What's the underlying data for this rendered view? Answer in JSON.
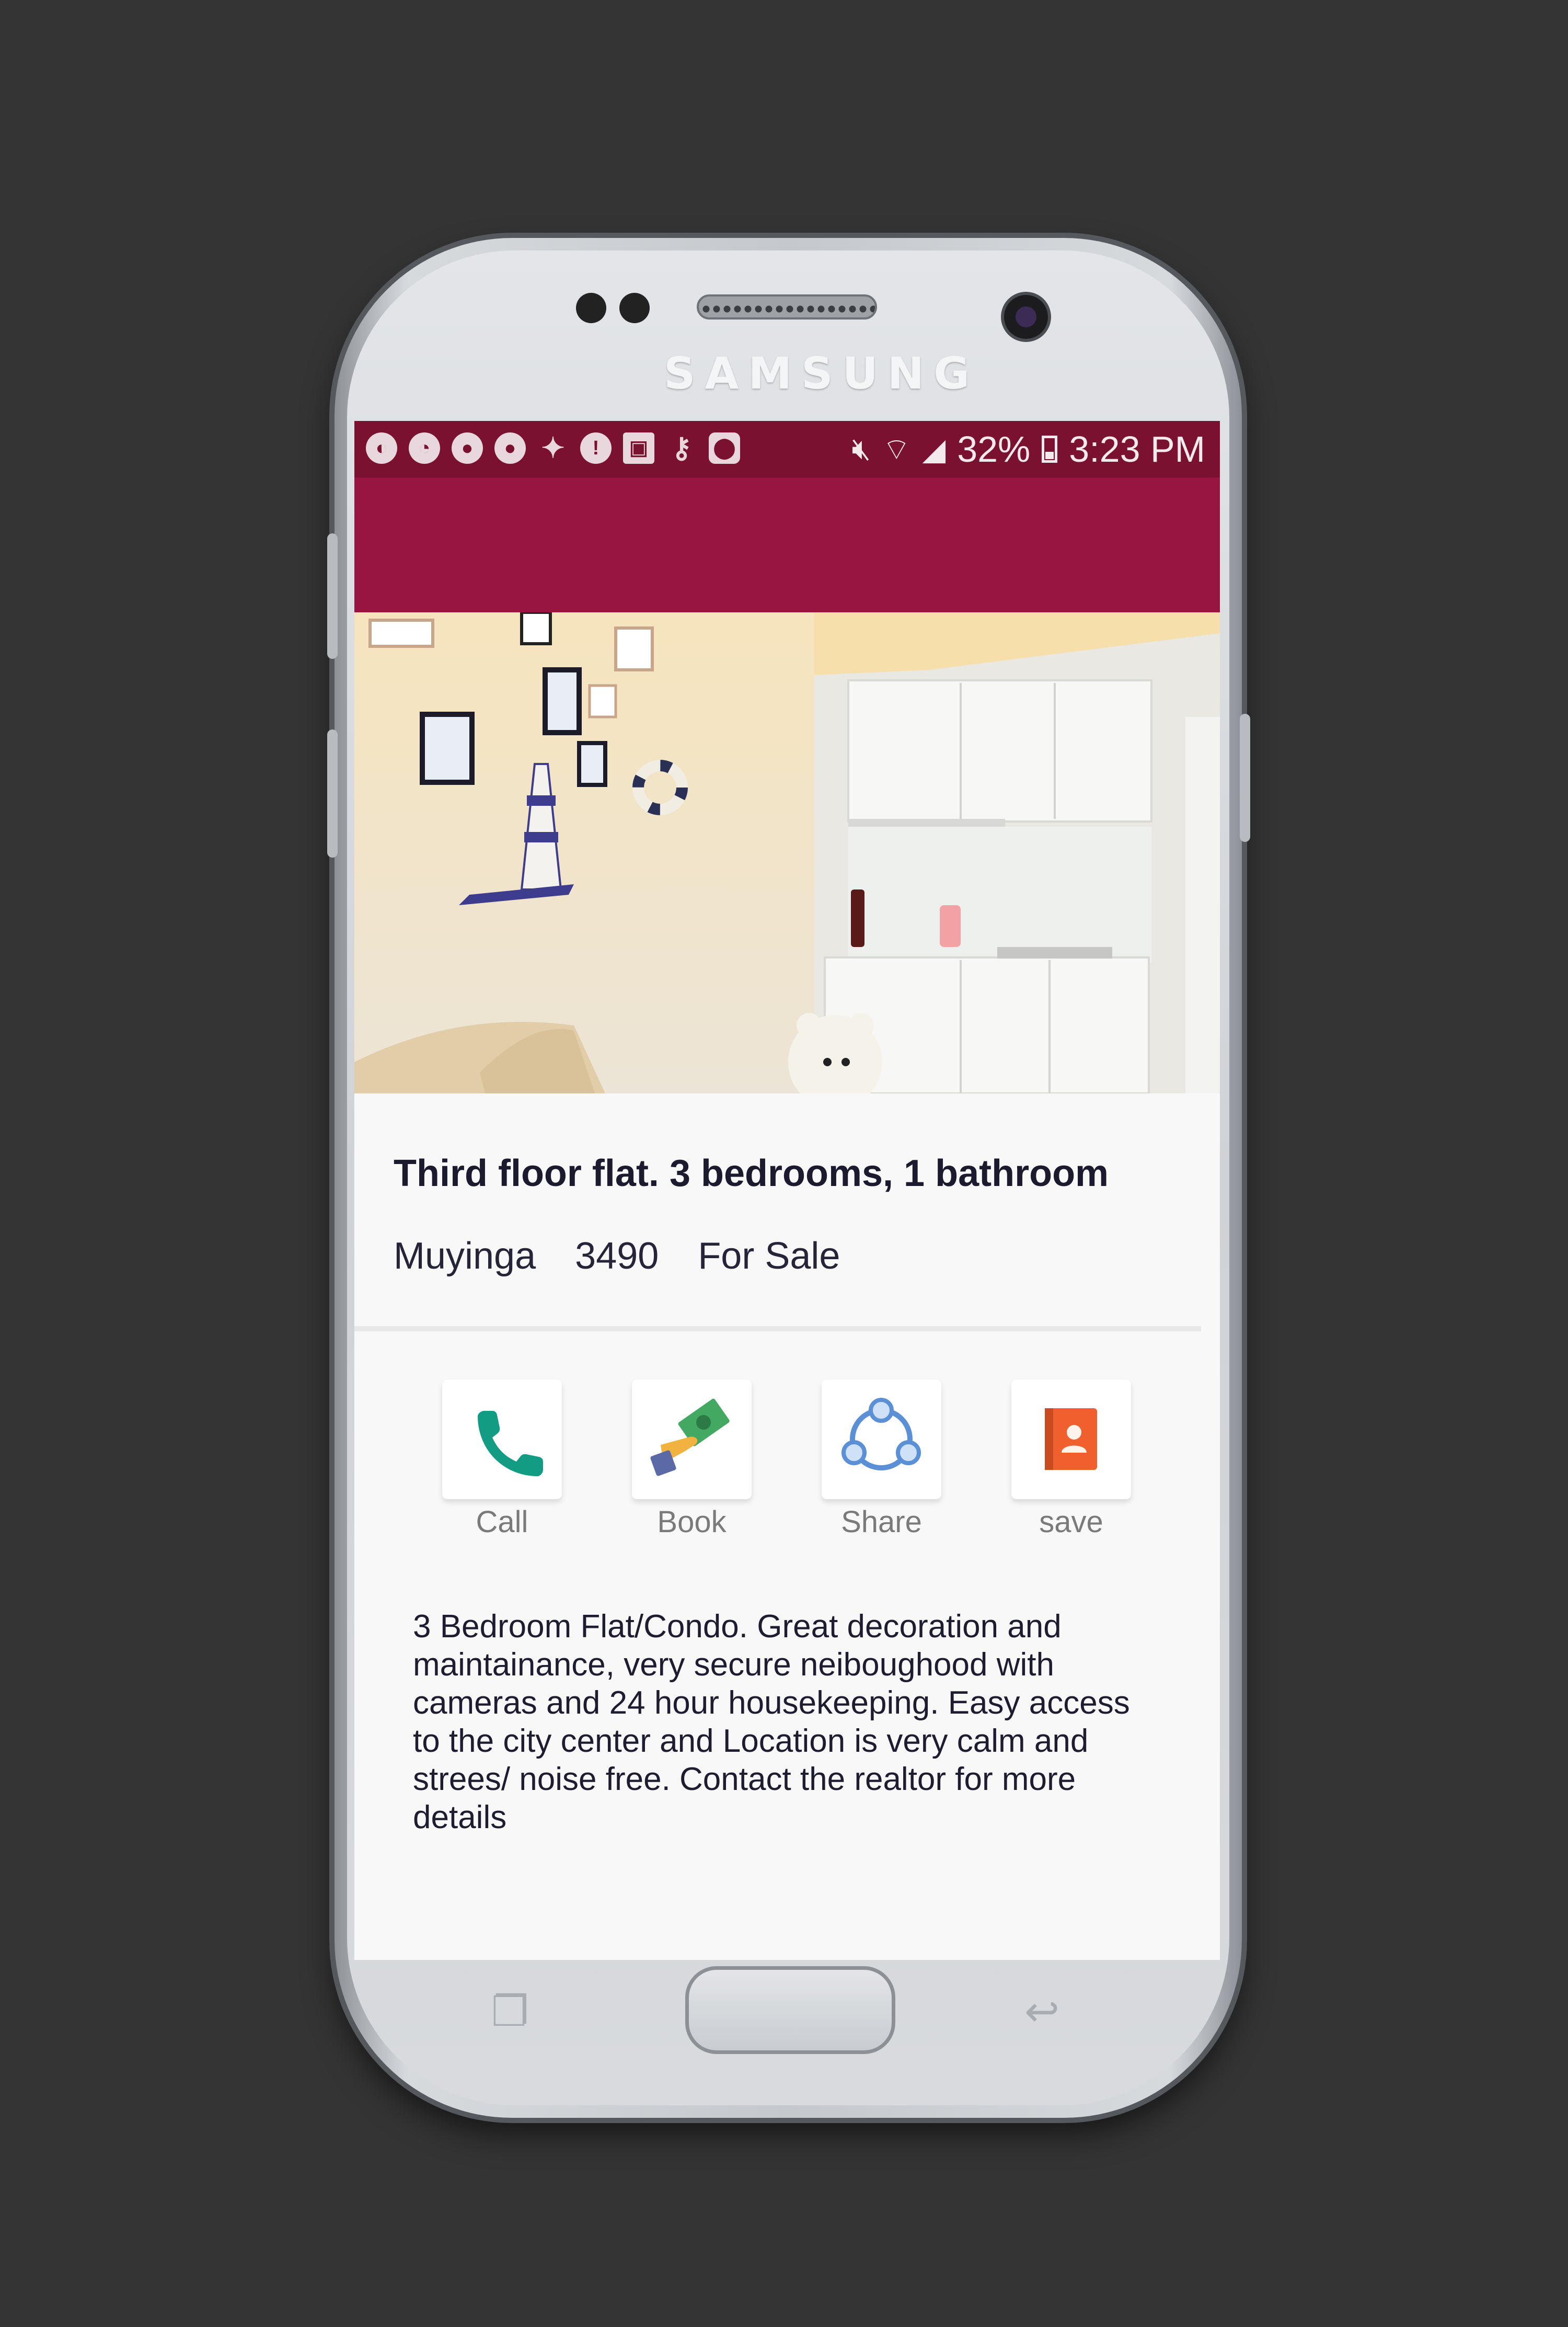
{
  "device": {
    "brand": "SAMSUNG"
  },
  "status_bar": {
    "notification_icons": [
      "globe-icon",
      "timer-icon",
      "wechat-icon",
      "wechat-icon",
      "twitter-icon",
      "chat-alert-icon",
      "image-icon",
      "key-icon",
      "map-pin-icon"
    ],
    "battery_percent": "32%",
    "time": "3:23 PM",
    "colors": {
      "background": "#7b1130"
    }
  },
  "app_bar": {
    "color": "#981441"
  },
  "listing": {
    "title": "Third floor flat. 3 bedrooms, 1 bathroom",
    "location": "Muyinga",
    "price": "3490",
    "status": "For Sale",
    "actions": [
      {
        "label": "Call",
        "icon": "phone-icon",
        "color": "#129c83"
      },
      {
        "label": "Book",
        "icon": "money-hand-icon",
        "color": "#3aa36a"
      },
      {
        "label": "Share",
        "icon": "share-circle-icon",
        "color": "#5b8fd6"
      },
      {
        "label": "save",
        "icon": "contact-book-icon",
        "color": "#f0602f"
      }
    ],
    "description": "3 Bedroom Flat/Condo. Great decoration and maintainance, very secure neiboughood with cameras and 24 hour housekeeping. Easy access to the city center and Location is very calm and strees/ noise free. Contact the realtor for more details"
  }
}
